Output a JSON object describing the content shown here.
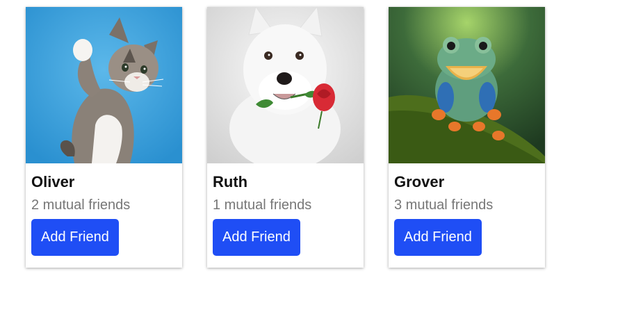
{
  "friends": [
    {
      "name": "Oliver",
      "mutual": "2 mutual friends",
      "button_label": "Add Friend",
      "photo_icon": "cat-photo"
    },
    {
      "name": "Ruth",
      "mutual": "1 mutual friends",
      "button_label": "Add Friend",
      "photo_icon": "dog-photo"
    },
    {
      "name": "Grover",
      "mutual": "3 mutual friends",
      "button_label": "Add Friend",
      "photo_icon": "frog-photo"
    }
  ],
  "colors": {
    "button_bg": "#1f4ef5",
    "button_text": "#ffffff",
    "mutual_text": "#777777"
  }
}
